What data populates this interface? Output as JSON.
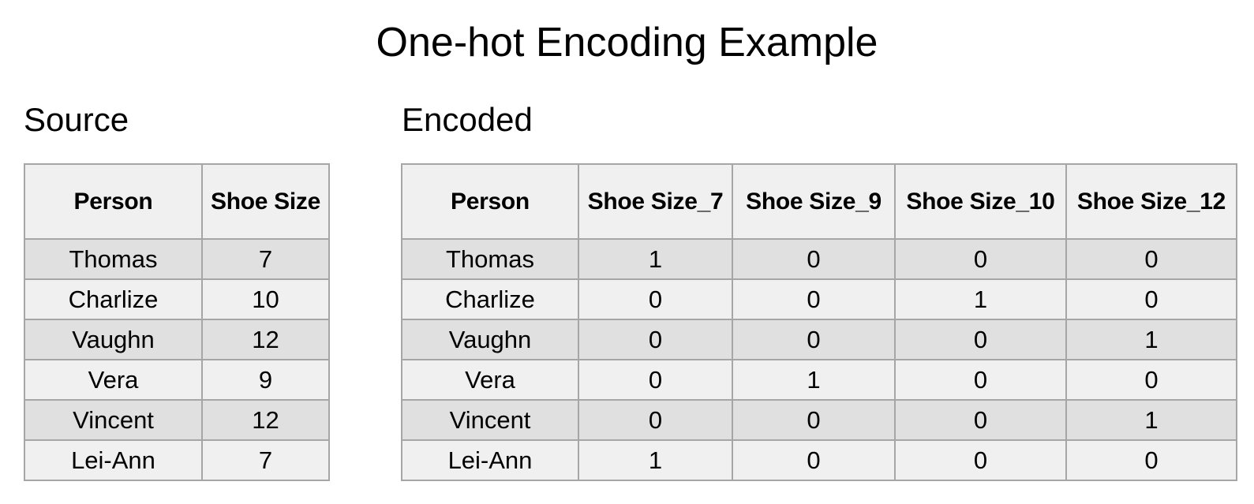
{
  "title": "One-hot Encoding Example",
  "source": {
    "label": "Source",
    "headers": [
      "Person",
      "Shoe Size"
    ],
    "rows": [
      [
        "Thomas",
        "7"
      ],
      [
        "Charlize",
        "10"
      ],
      [
        "Vaughn",
        "12"
      ],
      [
        "Vera",
        "9"
      ],
      [
        "Vincent",
        "12"
      ],
      [
        "Lei-Ann",
        "7"
      ]
    ]
  },
  "encoded": {
    "label": "Encoded",
    "headers": [
      "Person",
      "Shoe Size_7",
      "Shoe Size_9",
      "Shoe Size_10",
      "Shoe Size_12"
    ],
    "rows": [
      [
        "Thomas",
        "1",
        "0",
        "0",
        "0"
      ],
      [
        "Charlize",
        "0",
        "0",
        "1",
        "0"
      ],
      [
        "Vaughn",
        "0",
        "0",
        "0",
        "1"
      ],
      [
        "Vera",
        "0",
        "1",
        "0",
        "0"
      ],
      [
        "Vincent",
        "0",
        "0",
        "0",
        "1"
      ],
      [
        "Lei-Ann",
        "1",
        "0",
        "0",
        "0"
      ]
    ]
  },
  "colors": {
    "header_bg": "#f0f0f0",
    "row_dark": "#e0e0e0",
    "row_light": "#f0f0f0",
    "border": "#a6a6a6"
  }
}
